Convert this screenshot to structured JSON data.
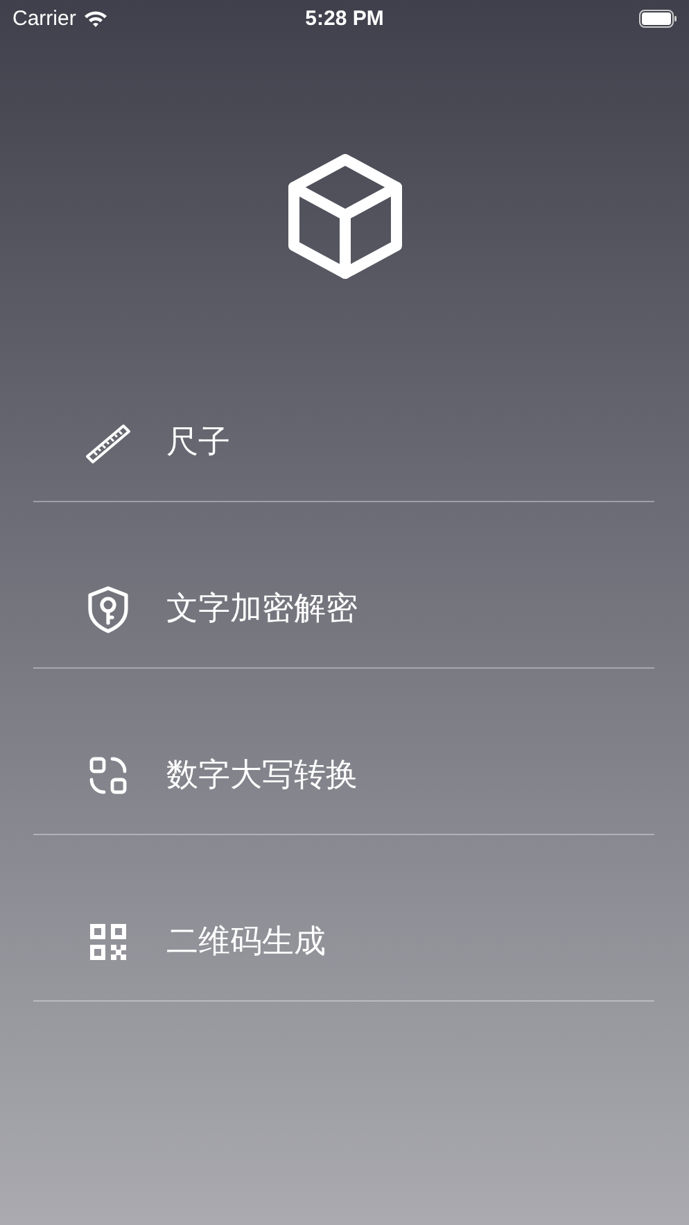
{
  "status_bar": {
    "carrier": "Carrier",
    "time": "5:28 PM"
  },
  "menu": [
    {
      "kind": "ruler",
      "label": "尺子"
    },
    {
      "kind": "shield",
      "label": "文字加密解密"
    },
    {
      "kind": "convert",
      "label": "数字大写转换"
    },
    {
      "kind": "qr",
      "label": "二维码生成"
    }
  ]
}
